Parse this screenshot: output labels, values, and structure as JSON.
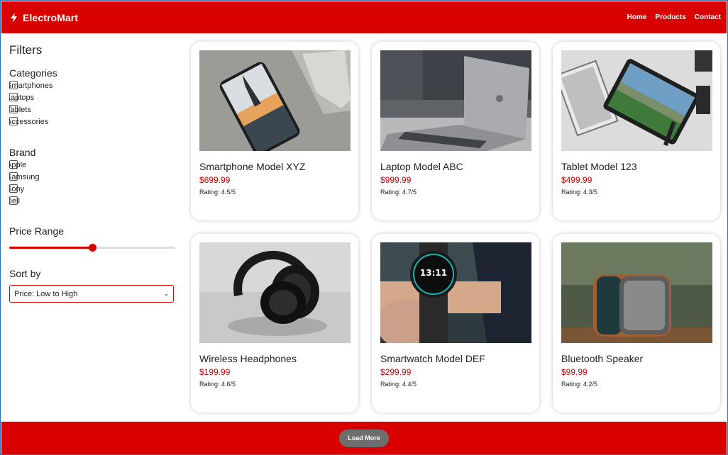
{
  "colors": {
    "brand": "#d90000",
    "button": "#6e6e6e"
  },
  "header": {
    "logo_icon": "bolt-icon",
    "brand": "ElectroMart",
    "nav": [
      "Home",
      "Products",
      "Contact"
    ]
  },
  "sidebar": {
    "title": "Filters",
    "categories_title": "Categories",
    "categories": [
      "Smartphones",
      "Laptops",
      "Tablets",
      "Accessories"
    ],
    "brand_title": "Brand",
    "brands": [
      "Apple",
      "Samsung",
      "Sony",
      "Dell"
    ],
    "price_title": "Price Range",
    "price_fraction": 0.5,
    "sort_title": "Sort by",
    "sort_value": "Price: Low to High"
  },
  "products": [
    {
      "title": "Smartphone Model XYZ",
      "price": "$699.99",
      "rating": "Rating: 4.5/5"
    },
    {
      "title": "Laptop Model ABC",
      "price": "$999.99",
      "rating": "Rating: 4.7/5"
    },
    {
      "title": "Tablet Model 123",
      "price": "$499.99",
      "rating": "Rating: 4.3/5"
    },
    {
      "title": "Wireless Headphones",
      "price": "$199.99",
      "rating": "Rating: 4.6/5"
    },
    {
      "title": "Smartwatch Model DEF",
      "price": "$299.99",
      "rating": "Rating: 4.4/5"
    },
    {
      "title": "Bluetooth Speaker",
      "price": "$99.99",
      "rating": "Rating: 4.2/5"
    }
  ],
  "footer": {
    "load_more": "Load More"
  }
}
